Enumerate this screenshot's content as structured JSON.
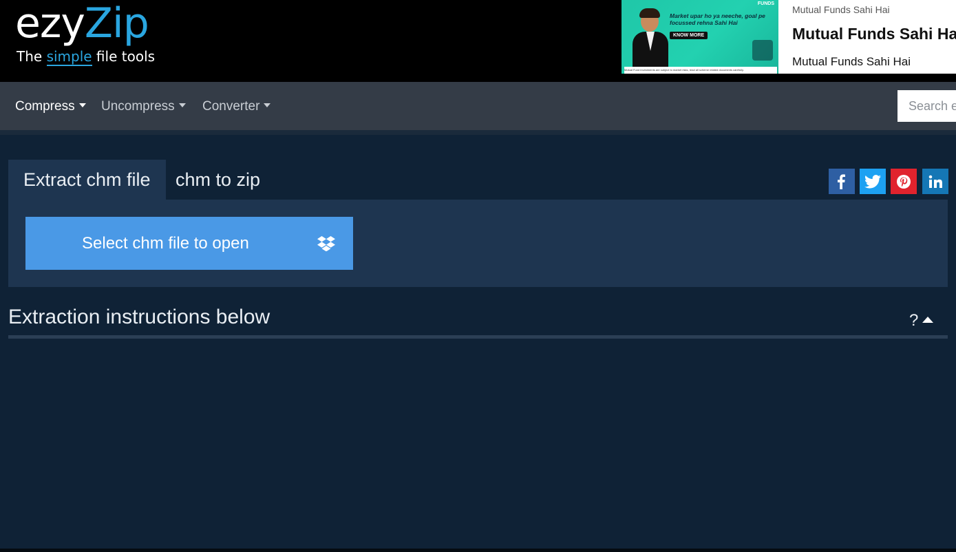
{
  "logo": {
    "word_a": "ezy",
    "word_b": "Zip",
    "tag_a": "The ",
    "tag_b": "simple",
    "tag_c": " file tools"
  },
  "ad": {
    "image_text": "Market upar ho ya neeche, goal pe focussed rehna Sahi Hai",
    "image_button": "KNOW MORE",
    "image_brand": "FUNDS",
    "image_fine": "Mutual Fund investments are subject to market risks, read all scheme related documents carefully.",
    "line1": "Mutual Funds Sahi Hai",
    "line2": "Mutual Funds Sahi Hai",
    "line3": "Mutual Funds Sahi Hai"
  },
  "nav": {
    "items": [
      {
        "label": "Compress"
      },
      {
        "label": "Uncompress"
      },
      {
        "label": "Converter"
      }
    ],
    "search_placeholder": "Search e"
  },
  "tabs": [
    {
      "label": "Extract chm file"
    },
    {
      "label": "chm to zip"
    }
  ],
  "upload": {
    "label": "Select chm file to open"
  },
  "instructions": {
    "title": "Extraction instructions below",
    "help": "?"
  },
  "colors": {
    "accent": "#4a99e6",
    "brand": "#2aa6e0",
    "background": "#0f2236",
    "panel": "#1e3550"
  },
  "icons": [
    "dropbox-icon",
    "facebook-icon",
    "twitter-icon",
    "pinterest-icon",
    "linkedin-icon",
    "caret-up-icon"
  ]
}
